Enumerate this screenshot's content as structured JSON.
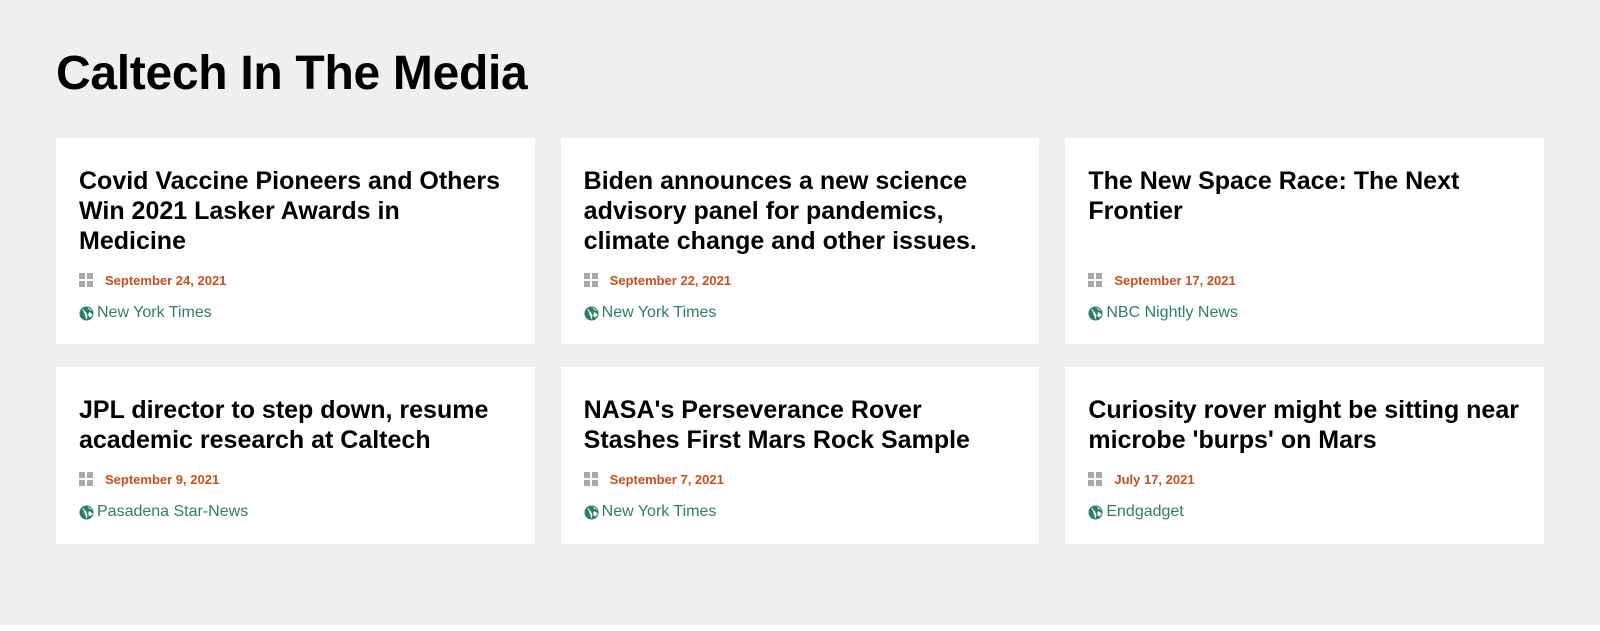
{
  "section": {
    "title": "Caltech In The Media"
  },
  "articles": [
    {
      "title": "Covid Vaccine Pioneers and Others Win 2021 Lasker Awards in Medicine",
      "date": "September 24, 2021",
      "source": "New York Times"
    },
    {
      "title": "Biden announces a new science advisory panel for pandemics, climate change and other issues.",
      "date": "September 22, 2021",
      "source": "New York Times"
    },
    {
      "title": "The New Space Race: The Next Frontier",
      "date": "September 17, 2021",
      "source": "NBC Nightly News"
    },
    {
      "title": "JPL director to step down, resume academic research at Caltech",
      "date": "September 9, 2021",
      "source": "Pasadena Star-News"
    },
    {
      "title": "NASA's Perseverance Rover Stashes First Mars Rock Sample",
      "date": "September 7, 2021",
      "source": "New York Times"
    },
    {
      "title": "Curiosity rover might be sitting near microbe 'burps' on Mars",
      "date": "July 17, 2021",
      "source": "Endgadget"
    }
  ],
  "icons": {
    "date": "grid-icon",
    "source": "globe-icon"
  },
  "colors": {
    "background": "#efefef",
    "date": "#c8501e",
    "source": "#2f7d6b",
    "icon_gray": "#a9a9a9"
  }
}
